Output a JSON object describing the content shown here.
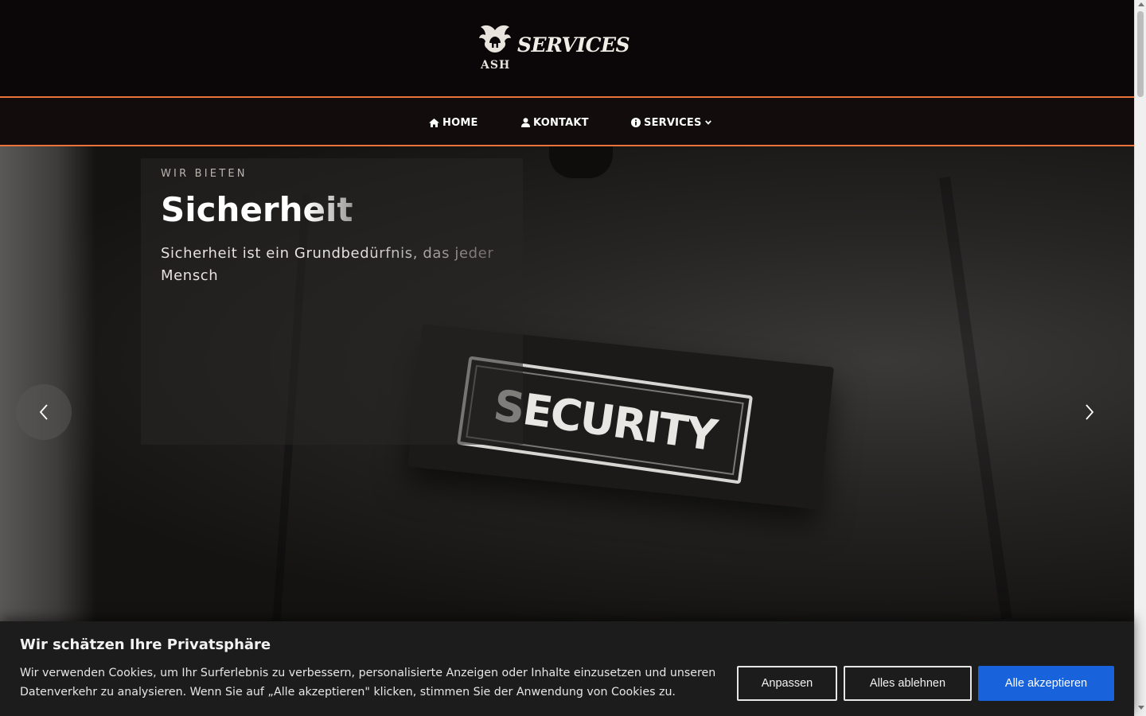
{
  "header": {
    "logo_small": "ASH",
    "logo_large": "SERVICES"
  },
  "nav": {
    "items": [
      {
        "label": "HOME",
        "icon": "home-icon"
      },
      {
        "label": "KONTAKT",
        "icon": "user-icon"
      },
      {
        "label": "SERVICES",
        "icon": "info-circle-icon",
        "has_dropdown": true
      }
    ],
    "accent_color": "#e8743b"
  },
  "hero": {
    "kicker": "WIR BIETEN",
    "title": "Sicherheit",
    "text": "Sicherheit ist ein Grundbedürfnis, das jeder Mensch",
    "badge_text": "SECURITY",
    "prev_icon": "chevron-left-icon",
    "next_icon": "chevron-right-icon"
  },
  "cookie": {
    "title": "Wir schätzen Ihre Privatsphäre",
    "text": "Wir verwenden Cookies, um Ihr Surferlebnis zu verbessern, personalisierte Anzeigen oder Inhalte einzusetzen und unseren Datenverkehr zu analysieren. Wenn Sie auf „Alle akzeptieren\" klicken, stimmen Sie der Anwendung von Cookies zu.",
    "buttons": {
      "customize": "Anpassen",
      "reject": "Alles ablehnen",
      "accept": "Alle akzeptieren"
    },
    "accept_color": "#1863dc"
  }
}
